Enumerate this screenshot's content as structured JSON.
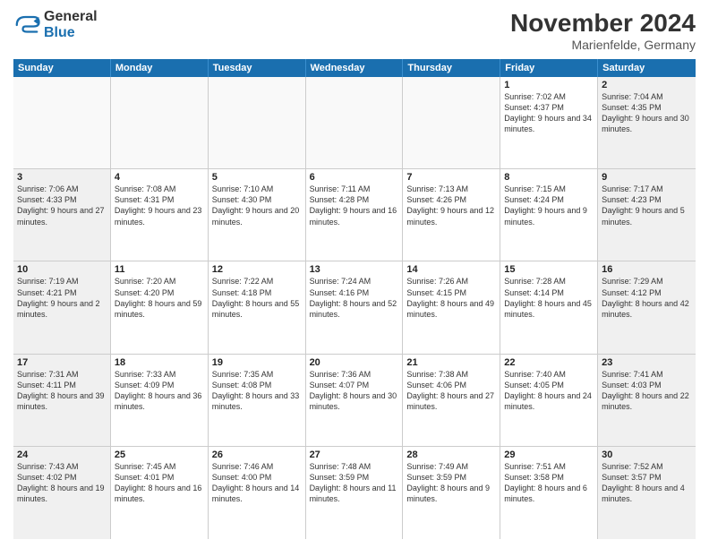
{
  "logo": {
    "general": "General",
    "blue": "Blue"
  },
  "title": "November 2024",
  "location": "Marienfelde, Germany",
  "days": [
    "Sunday",
    "Monday",
    "Tuesday",
    "Wednesday",
    "Thursday",
    "Friday",
    "Saturday"
  ],
  "weeks": [
    [
      {
        "day": "",
        "info": ""
      },
      {
        "day": "",
        "info": ""
      },
      {
        "day": "",
        "info": ""
      },
      {
        "day": "",
        "info": ""
      },
      {
        "day": "",
        "info": ""
      },
      {
        "day": "1",
        "info": "Sunrise: 7:02 AM\nSunset: 4:37 PM\nDaylight: 9 hours and 34 minutes."
      },
      {
        "day": "2",
        "info": "Sunrise: 7:04 AM\nSunset: 4:35 PM\nDaylight: 9 hours and 30 minutes."
      }
    ],
    [
      {
        "day": "3",
        "info": "Sunrise: 7:06 AM\nSunset: 4:33 PM\nDaylight: 9 hours and 27 minutes."
      },
      {
        "day": "4",
        "info": "Sunrise: 7:08 AM\nSunset: 4:31 PM\nDaylight: 9 hours and 23 minutes."
      },
      {
        "day": "5",
        "info": "Sunrise: 7:10 AM\nSunset: 4:30 PM\nDaylight: 9 hours and 20 minutes."
      },
      {
        "day": "6",
        "info": "Sunrise: 7:11 AM\nSunset: 4:28 PM\nDaylight: 9 hours and 16 minutes."
      },
      {
        "day": "7",
        "info": "Sunrise: 7:13 AM\nSunset: 4:26 PM\nDaylight: 9 hours and 12 minutes."
      },
      {
        "day": "8",
        "info": "Sunrise: 7:15 AM\nSunset: 4:24 PM\nDaylight: 9 hours and 9 minutes."
      },
      {
        "day": "9",
        "info": "Sunrise: 7:17 AM\nSunset: 4:23 PM\nDaylight: 9 hours and 5 minutes."
      }
    ],
    [
      {
        "day": "10",
        "info": "Sunrise: 7:19 AM\nSunset: 4:21 PM\nDaylight: 9 hours and 2 minutes."
      },
      {
        "day": "11",
        "info": "Sunrise: 7:20 AM\nSunset: 4:20 PM\nDaylight: 8 hours and 59 minutes."
      },
      {
        "day": "12",
        "info": "Sunrise: 7:22 AM\nSunset: 4:18 PM\nDaylight: 8 hours and 55 minutes."
      },
      {
        "day": "13",
        "info": "Sunrise: 7:24 AM\nSunset: 4:16 PM\nDaylight: 8 hours and 52 minutes."
      },
      {
        "day": "14",
        "info": "Sunrise: 7:26 AM\nSunset: 4:15 PM\nDaylight: 8 hours and 49 minutes."
      },
      {
        "day": "15",
        "info": "Sunrise: 7:28 AM\nSunset: 4:14 PM\nDaylight: 8 hours and 45 minutes."
      },
      {
        "day": "16",
        "info": "Sunrise: 7:29 AM\nSunset: 4:12 PM\nDaylight: 8 hours and 42 minutes."
      }
    ],
    [
      {
        "day": "17",
        "info": "Sunrise: 7:31 AM\nSunset: 4:11 PM\nDaylight: 8 hours and 39 minutes."
      },
      {
        "day": "18",
        "info": "Sunrise: 7:33 AM\nSunset: 4:09 PM\nDaylight: 8 hours and 36 minutes."
      },
      {
        "day": "19",
        "info": "Sunrise: 7:35 AM\nSunset: 4:08 PM\nDaylight: 8 hours and 33 minutes."
      },
      {
        "day": "20",
        "info": "Sunrise: 7:36 AM\nSunset: 4:07 PM\nDaylight: 8 hours and 30 minutes."
      },
      {
        "day": "21",
        "info": "Sunrise: 7:38 AM\nSunset: 4:06 PM\nDaylight: 8 hours and 27 minutes."
      },
      {
        "day": "22",
        "info": "Sunrise: 7:40 AM\nSunset: 4:05 PM\nDaylight: 8 hours and 24 minutes."
      },
      {
        "day": "23",
        "info": "Sunrise: 7:41 AM\nSunset: 4:03 PM\nDaylight: 8 hours and 22 minutes."
      }
    ],
    [
      {
        "day": "24",
        "info": "Sunrise: 7:43 AM\nSunset: 4:02 PM\nDaylight: 8 hours and 19 minutes."
      },
      {
        "day": "25",
        "info": "Sunrise: 7:45 AM\nSunset: 4:01 PM\nDaylight: 8 hours and 16 minutes."
      },
      {
        "day": "26",
        "info": "Sunrise: 7:46 AM\nSunset: 4:00 PM\nDaylight: 8 hours and 14 minutes."
      },
      {
        "day": "27",
        "info": "Sunrise: 7:48 AM\nSunset: 3:59 PM\nDaylight: 8 hours and 11 minutes."
      },
      {
        "day": "28",
        "info": "Sunrise: 7:49 AM\nSunset: 3:59 PM\nDaylight: 8 hours and 9 minutes."
      },
      {
        "day": "29",
        "info": "Sunrise: 7:51 AM\nSunset: 3:58 PM\nDaylight: 8 hours and 6 minutes."
      },
      {
        "day": "30",
        "info": "Sunrise: 7:52 AM\nSunset: 3:57 PM\nDaylight: 8 hours and 4 minutes."
      }
    ]
  ]
}
